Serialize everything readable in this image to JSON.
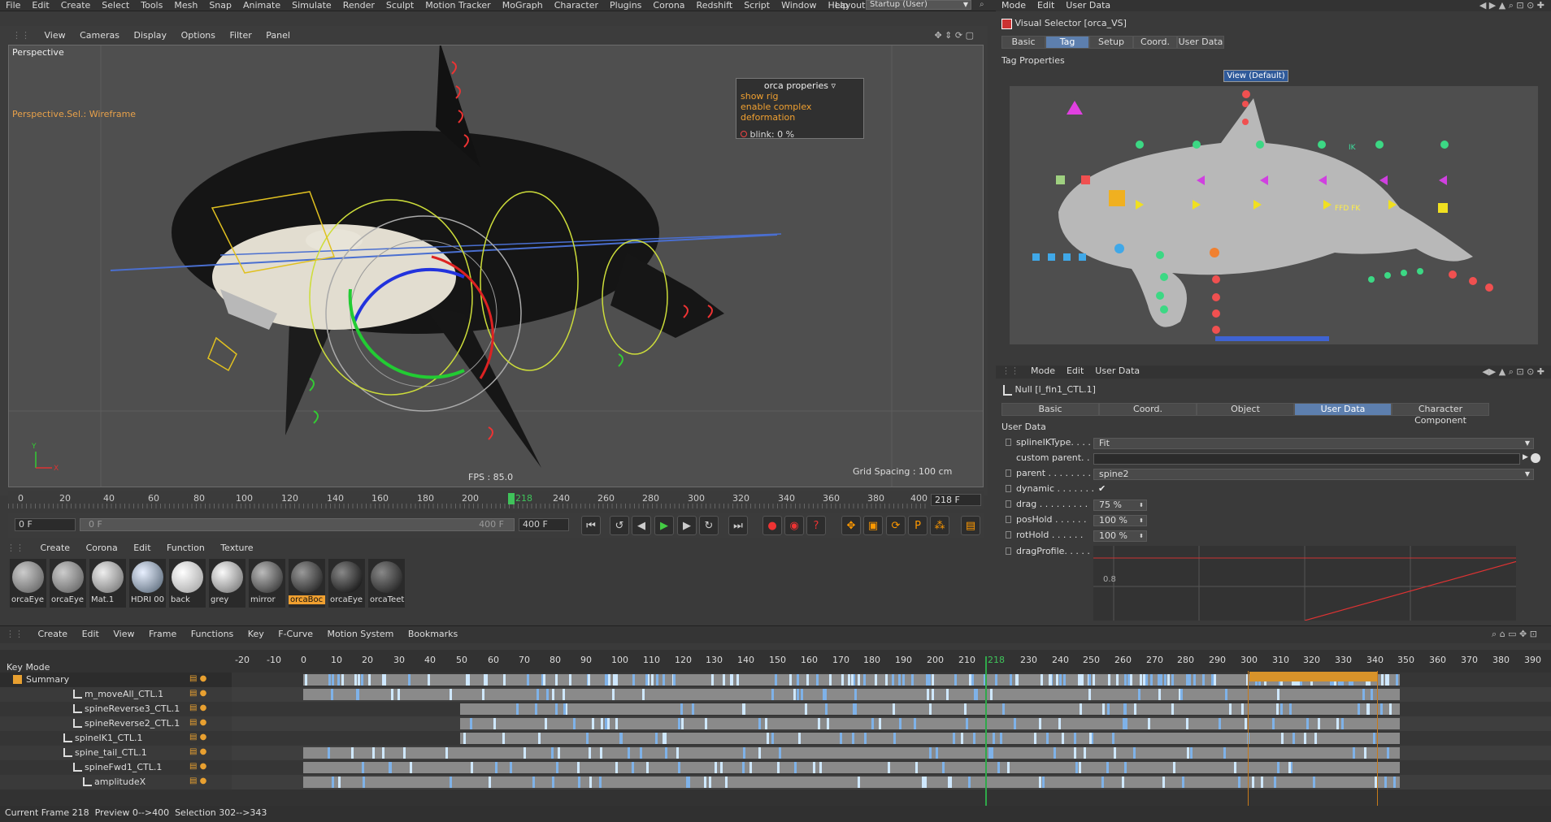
{
  "menu": [
    "File",
    "Edit",
    "Create",
    "Select",
    "Tools",
    "Mesh",
    "Snap",
    "Animate",
    "Simulate",
    "Render",
    "Sculpt",
    "Motion Tracker",
    "MoGraph",
    "Character",
    "Plugins",
    "Corona",
    "Redshift",
    "Script",
    "Window",
    "Help"
  ],
  "layout": {
    "label": "Layout:",
    "value": "Startup (User)"
  },
  "viewport": {
    "menu": [
      "View",
      "Cameras",
      "Display",
      "Options",
      "Filter",
      "Panel"
    ],
    "name": "Perspective",
    "sel_mode": "Perspective.Sel.: Wireframe",
    "fps": "FPS : 85.0",
    "grid_spacing": "Grid Spacing : 100 cm",
    "rig_panel": {
      "title": "orca properies",
      "show_rig": "show rig",
      "complex": "enable complex deformation",
      "blink": "blink:",
      "blink_val": "0 %"
    }
  },
  "timeline": {
    "ticks": [
      "0",
      "20",
      "40",
      "60",
      "80",
      "100",
      "120",
      "140",
      "160",
      "180",
      "200",
      "218",
      "240",
      "260",
      "280",
      "300",
      "320",
      "340",
      "360",
      "380",
      "400"
    ],
    "end_field": "218 F",
    "current_frame": 218
  },
  "transport": {
    "start": "0 F",
    "range_start": "0 F",
    "range_end": "400 F",
    "end": "400 F"
  },
  "materials": {
    "menu": [
      "Create",
      "Corona",
      "Edit",
      "Function",
      "Texture"
    ],
    "items": [
      {
        "name": "orcaEye",
        "color": "#8a8a8a"
      },
      {
        "name": "orcaEye",
        "color": "#7d7d7d"
      },
      {
        "name": "Mat.1",
        "color": "#a9a9a9"
      },
      {
        "name": "HDRI 00",
        "color": "#9aaab8"
      },
      {
        "name": "back",
        "color": "#bcbcbc"
      },
      {
        "name": "grey",
        "color": "#b0b0b0"
      },
      {
        "name": "mirror",
        "color": "#6e6e6e"
      },
      {
        "name": "orcaBoc",
        "color": "#333333"
      },
      {
        "name": "orcaEye",
        "color": "#2a2a2a"
      },
      {
        "name": "orcaTeet",
        "color": "#3a3a3a"
      }
    ],
    "selected_index": 7
  },
  "vs": {
    "menu": [
      "Mode",
      "Edit",
      "User Data"
    ],
    "title": "Visual Selector [orca_VS]",
    "tabs": [
      "Basic",
      "Tag",
      "Setup",
      "Coord.",
      "User Data"
    ],
    "active_tab": "Tag",
    "section": "Tag Properties",
    "view_button": "View (Default)",
    "labels": {
      "ik": "IK",
      "ffd": "FFD FK"
    }
  },
  "attr": {
    "menu": [
      "Mode",
      "Edit",
      "User Data"
    ],
    "object": "Null [l_fin1_CTL.1]",
    "tabs": [
      "Basic",
      "Coord.",
      "Object",
      "User Data",
      "Character Component"
    ],
    "active_tab": "User Data",
    "section": "User Data",
    "rows": [
      {
        "label": "splineIKType. . . . .",
        "value": "Fit",
        "kind": "dropdown"
      },
      {
        "label": "custom parent. . .",
        "value": "",
        "kind": "link"
      },
      {
        "label": "parent . . . . . . . .",
        "value": "spine2",
        "kind": "dropdown"
      },
      {
        "label": "dynamic . . . . . . .",
        "value": "✔",
        "kind": "check"
      },
      {
        "label": "drag . . . . . . . . .",
        "value": "75 %",
        "kind": "num"
      },
      {
        "label": "posHold . . . . . .",
        "value": "100 %",
        "kind": "num"
      },
      {
        "label": "rotHold . . . . . .",
        "value": "100 %",
        "kind": "num"
      },
      {
        "label": "dragProfile. . . . .",
        "value": "",
        "kind": "graph"
      }
    ],
    "graph_label": "0.8"
  },
  "dopesheet": {
    "menu": [
      "Create",
      "Edit",
      "View",
      "Frame",
      "Functions",
      "Key",
      "F-Curve",
      "Motion System",
      "Bookmarks"
    ],
    "mode": "Key Mode",
    "ruler": [
      "-20",
      "-10",
      "0",
      "10",
      "20",
      "30",
      "40",
      "50",
      "60",
      "70",
      "80",
      "90",
      "100",
      "110",
      "120",
      "130",
      "140",
      "150",
      "160",
      "170",
      "180",
      "190",
      "200",
      "210",
      "218",
      "230",
      "240",
      "250",
      "260",
      "270",
      "280",
      "290",
      "300",
      "310",
      "320",
      "330",
      "340",
      "350",
      "360",
      "370",
      "380",
      "390"
    ],
    "rows": [
      {
        "name": "Summary",
        "indent": 0,
        "folder": true
      },
      {
        "name": "m_moveAll_CTL.1",
        "indent": 3
      },
      {
        "name": "spineReverse3_CTL.1",
        "indent": 3
      },
      {
        "name": "spineReverse2_CTL.1",
        "indent": 3
      },
      {
        "name": "spineIK1_CTL.1",
        "indent": 2
      },
      {
        "name": "spine_tail_CTL.1",
        "indent": 2
      },
      {
        "name": "spineFwd1_CTL.1",
        "indent": 3
      },
      {
        "name": "amplitudeX",
        "indent": 4
      }
    ]
  },
  "status": {
    "frame_label": "Current Frame",
    "frame": "218",
    "preview_label": "Preview",
    "preview": "0-->400",
    "selection_label": "Selection",
    "selection": "302-->343"
  }
}
